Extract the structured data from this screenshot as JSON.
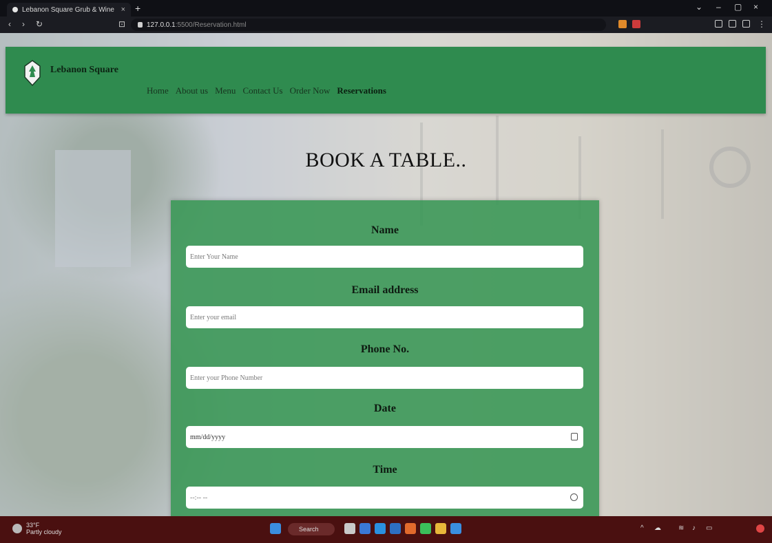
{
  "browser": {
    "tab_title": "Lebanon Square Grub & Wine",
    "url_host": "127.0.0.1",
    "url_path": ":5500/Reservation.html"
  },
  "site": {
    "brand": "Lebanon Square",
    "nav": [
      "Home",
      "About us",
      "Menu",
      "Contact Us",
      "Order Now",
      "Reservations"
    ],
    "active_nav": "Reservations"
  },
  "booking": {
    "heading": "BOOK A TABLE..",
    "name_label": "Name",
    "name_placeholder": "Enter Your Name",
    "email_label": "Email address",
    "email_placeholder": "Enter your email",
    "phone_label": "Phone No.",
    "phone_placeholder": "Enter your Phone Number",
    "date_label": "Date",
    "date_placeholder": "mm/dd/yyyy",
    "time_label": "Time",
    "time_placeholder": "--:-- --"
  },
  "taskbar": {
    "weather_temp": "33°F",
    "weather_desc": "Partly cloudy",
    "search_label": "Search"
  },
  "colors": {
    "navbar": "#2f8b4f",
    "form": "#389654",
    "taskbar": "#4a1010"
  }
}
